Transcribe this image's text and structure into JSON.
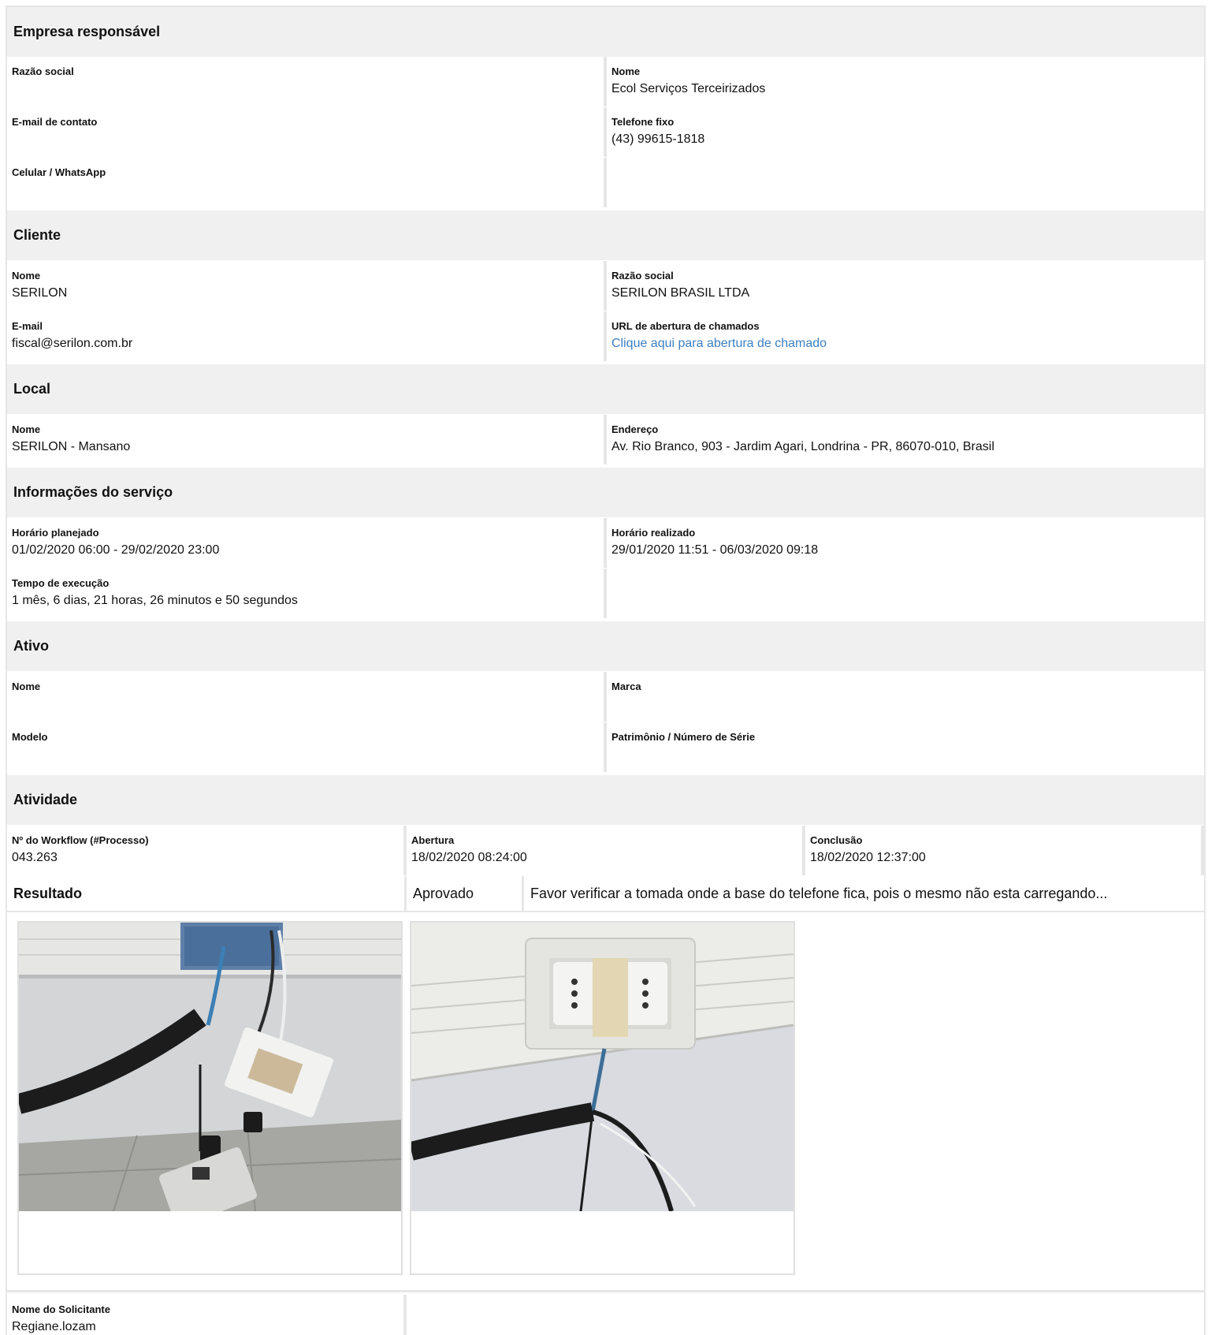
{
  "empresa": {
    "title": "Empresa responsável",
    "razao_social_label": "Razão social",
    "razao_social_value": "",
    "nome_label": "Nome",
    "nome_value": "Ecol Serviços Terceirizados",
    "email_label": "E-mail de contato",
    "email_value": "",
    "telefone_label": "Telefone fixo",
    "telefone_value": "(43) 99615-1818",
    "celular_label": "Celular / WhatsApp",
    "celular_value": ""
  },
  "cliente": {
    "title": "Cliente",
    "nome_label": "Nome",
    "nome_value": "SERILON",
    "razao_social_label": "Razão social",
    "razao_social_value": "SERILON BRASIL LTDA",
    "email_label": "E-mail",
    "email_value": "fiscal@serilon.com.br",
    "url_label": "URL de abertura de chamados",
    "url_link_text": "Clique aqui para abertura de chamado"
  },
  "local": {
    "title": "Local",
    "nome_label": "Nome",
    "nome_value": "SERILON - Mansano",
    "endereco_label": "Endereço",
    "endereco_value": "Av. Rio Branco, 903 - Jardim Agari, Londrina - PR, 86070-010, Brasil"
  },
  "servico": {
    "title": "Informações do serviço",
    "planejado_label": "Horário planejado",
    "planejado_value": "01/02/2020 06:00 - 29/02/2020 23:00",
    "realizado_label": "Horário realizado",
    "realizado_value": "29/01/2020 11:51 - 06/03/2020 09:18",
    "tempo_label": "Tempo de execução",
    "tempo_value": "1 mês, 6 dias, 21 horas, 26 minutos e 50 segundos"
  },
  "ativo": {
    "title": "Ativo",
    "nome_label": "Nome",
    "marca_label": "Marca",
    "modelo_label": "Modelo",
    "patrimonio_label": "Patrimônio / Número de Série"
  },
  "atividade": {
    "title": "Atividade",
    "workflow_label": "Nº do Workflow (#Processo)",
    "workflow_value": "043.263",
    "abertura_label": "Abertura",
    "abertura_value": "18/02/2020 08:24:00",
    "conclusao_label": "Conclusão",
    "conclusao_value": "18/02/2020 12:37:00",
    "resultado_label": "Resultado",
    "resultado_status": "Aprovado",
    "resultado_comment": "Favor verificar a tomada onde a base do telefone fica, pois o mesmo não esta carregando...",
    "solicitante_label": "Nome do Solicitante",
    "solicitante_value": "Regiane.lozam"
  },
  "photos": [
    {
      "icon": "photo-phone-socket-cables"
    },
    {
      "icon": "photo-wall-outlet"
    }
  ],
  "colors": {
    "section_bg": "#f0f0f0",
    "border": "#e6e6e6",
    "link": "#3d7fc1"
  }
}
